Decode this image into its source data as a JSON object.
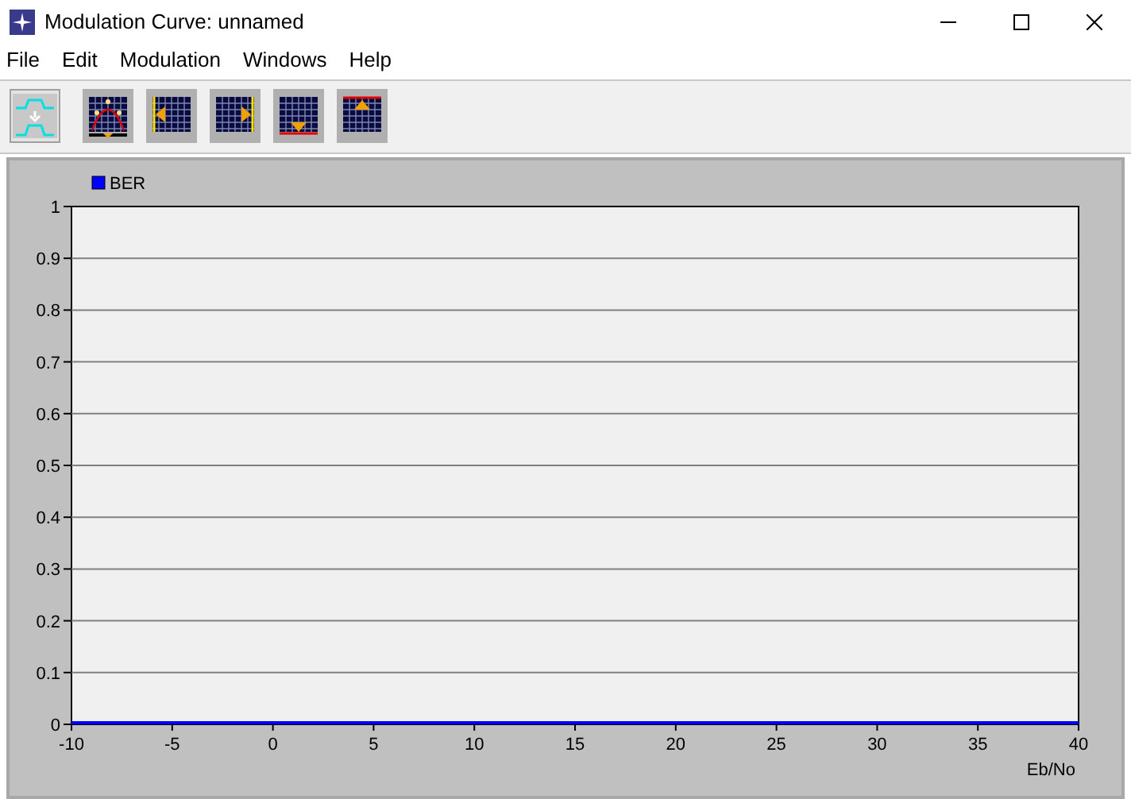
{
  "window": {
    "title": "Modulation Curve: unnamed"
  },
  "menu": [
    "File",
    "Edit",
    "Modulation",
    "Windows",
    "Help"
  ],
  "toolbar": [
    {
      "kind": "transfer",
      "selected": true
    },
    {
      "kind": "curve",
      "selected": false
    },
    {
      "kind": "left",
      "selected": false
    },
    {
      "kind": "right",
      "selected": false
    },
    {
      "kind": "bottom",
      "selected": false
    },
    {
      "kind": "top",
      "selected": false
    }
  ],
  "chart": {
    "chart_data": {
      "type": "line",
      "grid": true,
      "xlabel": "Eb/No",
      "x": [
        -10,
        40
      ],
      "series": [
        {
          "name": "BER",
          "color": "#0000ff",
          "values": [
            0,
            0
          ]
        }
      ],
      "xlim": [
        -10,
        40
      ],
      "ylim": [
        0,
        1
      ],
      "xticks": [
        -10,
        -5,
        0,
        5,
        10,
        15,
        20,
        25,
        30,
        35,
        40
      ],
      "yticks": [
        0,
        0.1,
        0.2,
        0.3,
        0.4,
        0.5,
        0.6,
        0.7,
        0.8,
        0.9,
        1
      ]
    }
  }
}
